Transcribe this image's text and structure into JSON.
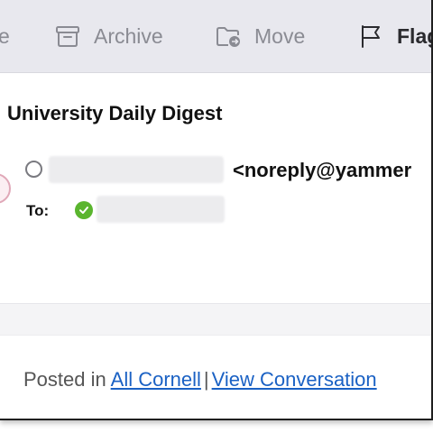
{
  "toolbar": {
    "prev_fragment": "e",
    "archive_label": "Archive",
    "move_label": "Move",
    "flag_label": "Flag"
  },
  "message": {
    "subject": "University Daily Digest",
    "sender_email": "<noreply@yammer",
    "to_label": "To:"
  },
  "footer": {
    "posted_in": "Posted in",
    "link_group": "All Cornell",
    "separator": "|",
    "link_conversation": "View Conversation"
  },
  "colors": {
    "toolbar_bg": "#e8e8ee",
    "link": "#1a61c4",
    "verified": "#5ab52e"
  }
}
